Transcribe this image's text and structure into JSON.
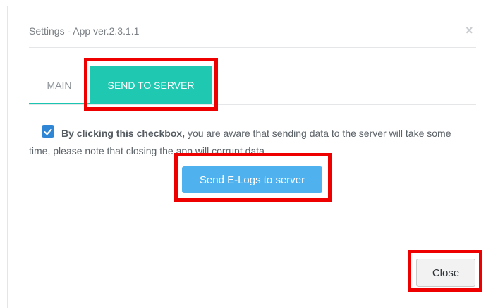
{
  "modal": {
    "title": "Settings - App ver.2.3.1.1",
    "close_glyph": "×"
  },
  "tabs": [
    {
      "label": "MAIN",
      "active": false
    },
    {
      "label": "SEND TO SERVER",
      "active": true
    }
  ],
  "notice": {
    "checked": true,
    "bold_text": "By clicking this checkbox,",
    "text": " you are aware that sending data to the server will take some time, please note that closing the app will corrupt data."
  },
  "buttons": {
    "send_label": "Send E-Logs to server",
    "close_label": "Close"
  },
  "colors": {
    "tab_active": "#1ec8b1",
    "send_button": "#4fb2ef",
    "checkbox": "#2f86d5",
    "highlight": "#ee0000"
  },
  "icons": {
    "close": "close-icon",
    "checkbox_check": "checkmark-icon"
  }
}
